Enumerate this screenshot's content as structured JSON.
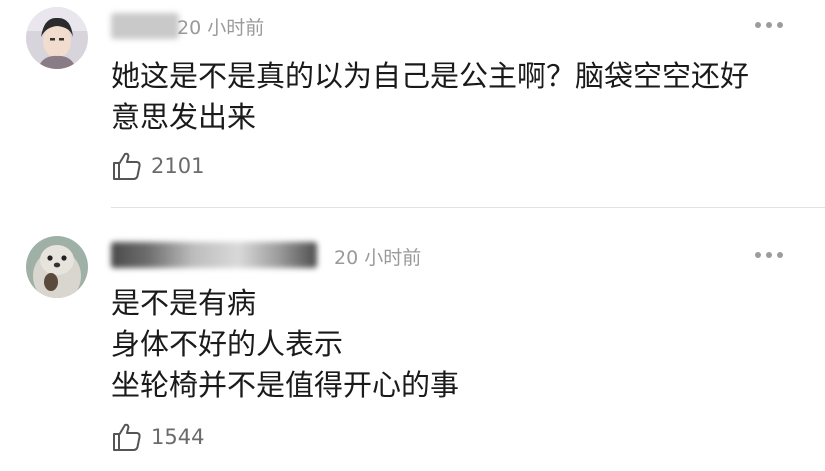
{
  "comments": [
    {
      "time": "20 小时前",
      "lines": [
        "她这是不是真的以为自己是公主啊？脑袋空空还好",
        "意思发出来"
      ],
      "likes": "2101"
    },
    {
      "time": "20 小时前",
      "lines": [
        "是不是有病",
        "身体不好的人表示",
        "坐轮椅并不是值得开心的事"
      ],
      "likes": "1544"
    }
  ],
  "icons": {
    "like": "thumbs-up-icon",
    "more": "more-dots-icon"
  },
  "colors": {
    "text": "#1a1a1a",
    "muted": "#9a9a9a",
    "like_count": "#6b6b6b",
    "divider": "#e2e2e2"
  }
}
